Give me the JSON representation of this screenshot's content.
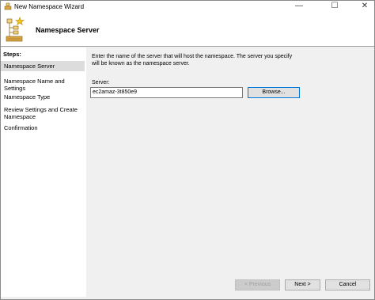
{
  "window": {
    "title": "New Namespace Wizard"
  },
  "header": {
    "title": "Namespace Server"
  },
  "steps": {
    "label": "Steps:",
    "items": [
      {
        "line1": "Namespace Server",
        "line2": ""
      },
      {
        "line1": "Namespace Name and Settings",
        "line2": ""
      },
      {
        "line1": "Namespace Type",
        "line2": ""
      },
      {
        "line1": "Review Settings and Create",
        "line2": "Namespace"
      },
      {
        "line1": "Confirmation",
        "line2": ""
      }
    ],
    "active_index": 0
  },
  "content": {
    "description_line1": "Enter the name of the server that will host the namespace. The server you specify",
    "description_line2": "will be known as the namespace server.",
    "server_label": "Server:",
    "server_value": "ec2amaz-3t850e9",
    "browse_label": "Browse..."
  },
  "footer": {
    "previous_label": "< Previous",
    "next_label": "Next >",
    "cancel_label": "Cancel"
  },
  "colors": {
    "selection": "#dcdcdc",
    "window_bg": "#f0f0f0",
    "focus_border": "#0078d7"
  },
  "icons": {
    "app": "namespace-wizard-icon",
    "banner": "namespace-tree-icon"
  }
}
